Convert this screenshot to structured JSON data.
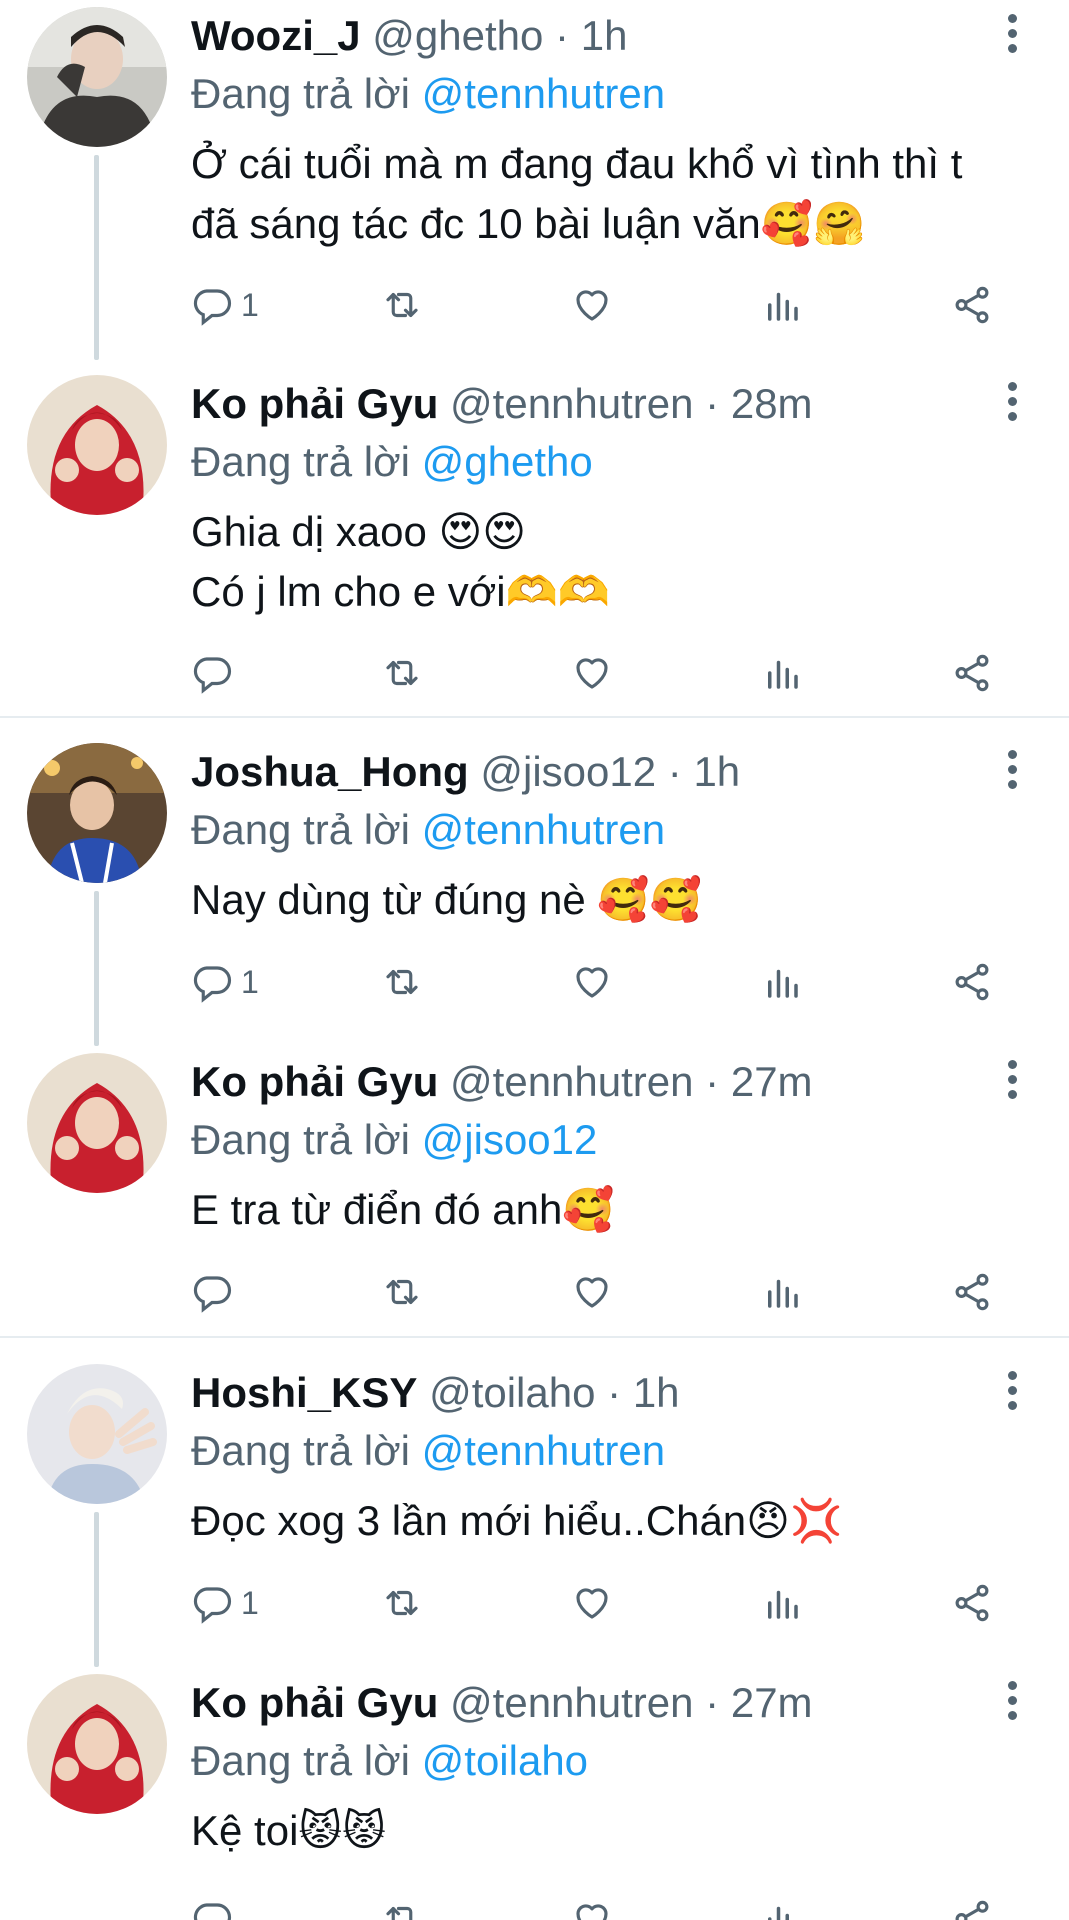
{
  "colors": {
    "link": "#1d9bf0",
    "muted": "#536471",
    "text": "#0f1419",
    "divider": "#e6ecf0"
  },
  "tweets": [
    {
      "name": "Woozi_J",
      "handle": "@ghetho",
      "time": "1h",
      "reply_prefix": "Đang trả lời",
      "reply_to": "@tennhutren",
      "lines": [
        "Ở cái tuổi mà m đang đau khổ vì tình thì t",
        "đã sáng tác đc 10 bài luận văn🥰🤗"
      ],
      "reply_count": "1",
      "avatar_icon": "avatar-woozi"
    },
    {
      "name": "Ko phải Gyu",
      "handle": "@tennhutren",
      "time": "28m",
      "reply_prefix": "Đang trả lời",
      "reply_to": "@ghetho",
      "lines": [
        "Ghia dị xaoo 😍😍",
        "Có j lm cho e với🫶🫶"
      ],
      "reply_count": "",
      "avatar_icon": "avatar-gyu"
    },
    {
      "name": "Joshua_Hong",
      "handle": "@jisoo12",
      "time": "1h",
      "reply_prefix": "Đang trả lời",
      "reply_to": "@tennhutren",
      "lines": [
        "Nay dùng từ đúng nè 🥰🥰"
      ],
      "reply_count": "1",
      "avatar_icon": "avatar-joshua"
    },
    {
      "name": "Ko phải Gyu",
      "handle": "@tennhutren",
      "time": "27m",
      "reply_prefix": "Đang trả lời",
      "reply_to": "@jisoo12",
      "lines": [
        "E tra từ điển đó anh🥰"
      ],
      "reply_count": "",
      "avatar_icon": "avatar-gyu"
    },
    {
      "name": "Hoshi_KSY",
      "handle": "@toilaho",
      "time": "1h",
      "reply_prefix": "Đang trả lời",
      "reply_to": "@tennhutren",
      "lines": [
        "Đọc xog 3 lần mới hiểu..Chán😠💢"
      ],
      "reply_count": "1",
      "avatar_icon": "avatar-hoshi"
    },
    {
      "name": "Ko phải Gyu",
      "handle": "@tennhutren",
      "time": "27m",
      "reply_prefix": "Đang trả lời",
      "reply_to": "@toilaho",
      "lines": [
        "Kệ toi😾😾"
      ],
      "reply_count": "",
      "avatar_icon": "avatar-gyu"
    }
  ]
}
